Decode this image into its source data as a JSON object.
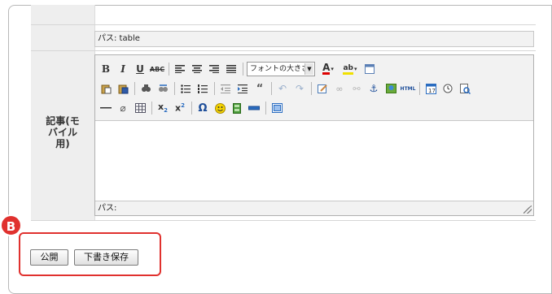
{
  "top_path": "パス: table",
  "field_label": "記事(モ\nバイル\n用)",
  "editor": {
    "bottom_path": "パス:",
    "font_size_select": "フォントの大きさ",
    "toolbar_row1": [
      "bold-icon",
      "italic-icon",
      "underline-icon",
      "strikethrough-icon",
      "|",
      "align-left-icon",
      "align-center-icon",
      "align-right-icon",
      "align-justify-icon",
      "|",
      "SELECT",
      "text-color-icon",
      "bg-color-icon",
      "fullscreen-icon"
    ],
    "toolbar_row2": [
      "paste-text-icon",
      "paste-word-icon",
      "|",
      "find-icon",
      "replace-icon",
      "|",
      "bullet-list-icon",
      "number-list-icon",
      "|",
      "outdent-icon",
      "indent-icon",
      "blockquote-icon",
      "|",
      "undo-icon",
      "redo-icon",
      "|",
      "edit-icon",
      "link-icon",
      "unlink-icon",
      "anchor-icon",
      "image-icon",
      "html-icon",
      "|",
      "insert-date-icon",
      "insert-time-icon",
      "preview-icon"
    ],
    "toolbar_row3": [
      "horizontal-rule-icon",
      "remove-format-icon",
      "table-icon",
      "|",
      "subscript-icon",
      "superscript-icon",
      "|",
      "special-char-icon",
      "emoticon-icon",
      "media-icon",
      "separator-line-icon",
      "|",
      "visual-aid-icon"
    ],
    "html_button_label": "HTML"
  },
  "badge": "B",
  "buttons": {
    "publish": "公開",
    "save_draft": "下書き保存"
  }
}
